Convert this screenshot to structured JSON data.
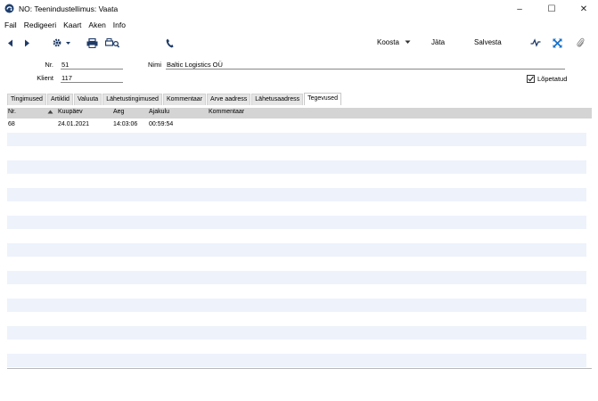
{
  "window": {
    "title": "NO: Teenindustellimus: Vaata",
    "controls": {
      "minimize": "–",
      "maximize": "☐",
      "close": "✕"
    }
  },
  "menu": [
    "Fail",
    "Redigeeri",
    "Kaart",
    "Aken",
    "Info"
  ],
  "toolbar": {
    "koosta": "Koosta",
    "jata": "Jäta",
    "salvesta": "Salvesta",
    "accent_color": "#1a73c9"
  },
  "header": {
    "nr_label": "Nr.",
    "nr_value": "51",
    "nimi_label": "Nimi",
    "nimi_value": "Baltic Logistics OÜ",
    "klient_label": "Klient",
    "klient_value": "117",
    "lopetatud_label": "Lõpetatud",
    "lopetatud_checked": true
  },
  "tabs": [
    {
      "label": "Tingimused"
    },
    {
      "label": "Artiklid"
    },
    {
      "label": "Valuuta"
    },
    {
      "label": "Lähetustingimused"
    },
    {
      "label": "Kommentaar"
    },
    {
      "label": "Arve aadress"
    },
    {
      "label": "Lähetusaadress"
    },
    {
      "label": "Tegevused",
      "active": true
    }
  ],
  "grid": {
    "columns": [
      "Nr.",
      "Kuupäev",
      "Aeg",
      "Ajakulu",
      "Kommentaar"
    ],
    "rows": [
      [
        "68",
        "24.01.2021",
        "14:03:06",
        "00:59:54",
        ""
      ],
      [
        "",
        "",
        "",
        "",
        ""
      ],
      [
        "",
        "",
        "",
        "",
        ""
      ],
      [
        "",
        "",
        "",
        "",
        ""
      ],
      [
        "",
        "",
        "",
        "",
        ""
      ],
      [
        "",
        "",
        "",
        "",
        ""
      ],
      [
        "",
        "",
        "",
        "",
        ""
      ],
      [
        "",
        "",
        "",
        "",
        ""
      ],
      [
        "",
        "",
        "",
        "",
        ""
      ],
      [
        "",
        "",
        "",
        "",
        ""
      ],
      [
        "",
        "",
        "",
        "",
        ""
      ],
      [
        "",
        "",
        "",
        "",
        ""
      ],
      [
        "",
        "",
        "",
        "",
        ""
      ],
      [
        "",
        "",
        "",
        "",
        ""
      ],
      [
        "",
        "",
        "",
        "",
        ""
      ],
      [
        "",
        "",
        "",
        "",
        ""
      ],
      [
        "",
        "",
        "",
        "",
        ""
      ],
      [
        "",
        "",
        "",
        "",
        ""
      ]
    ]
  }
}
